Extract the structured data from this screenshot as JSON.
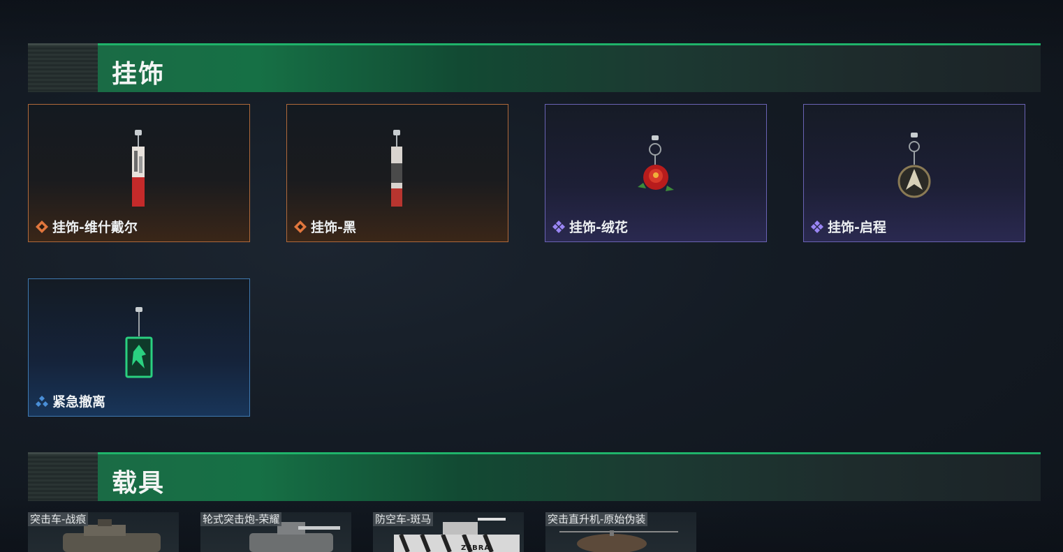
{
  "sections": {
    "charms": {
      "title": "挂饰"
    },
    "vehicles": {
      "title": "载具"
    }
  },
  "charms": [
    {
      "name": "挂饰-维什戴尔",
      "rarity": "orange",
      "icon": "charm-red-blade-icon"
    },
    {
      "name": "挂饰-黑",
      "rarity": "orange",
      "icon": "charm-dark-tag-icon"
    },
    {
      "name": "挂饰-绒花",
      "rarity": "purple",
      "icon": "charm-rose-icon"
    },
    {
      "name": "挂饰-启程",
      "rarity": "purple",
      "icon": "charm-compass-icon"
    },
    {
      "name": "紧急撤离",
      "rarity": "blue",
      "icon": "charm-green-emblem-icon"
    }
  ],
  "vehicles": [
    {
      "name": "突击车-战痕"
    },
    {
      "name": "轮式突击炮-荣耀"
    },
    {
      "name": "防空车-斑马",
      "badge": "ZEBRA"
    },
    {
      "name": "突击直升机-原始伪装"
    }
  ],
  "colors": {
    "orange": "#e0763d",
    "purple": "#8f7ef0",
    "blue": "#4a8fd8",
    "header_green": "#1fb36a"
  }
}
